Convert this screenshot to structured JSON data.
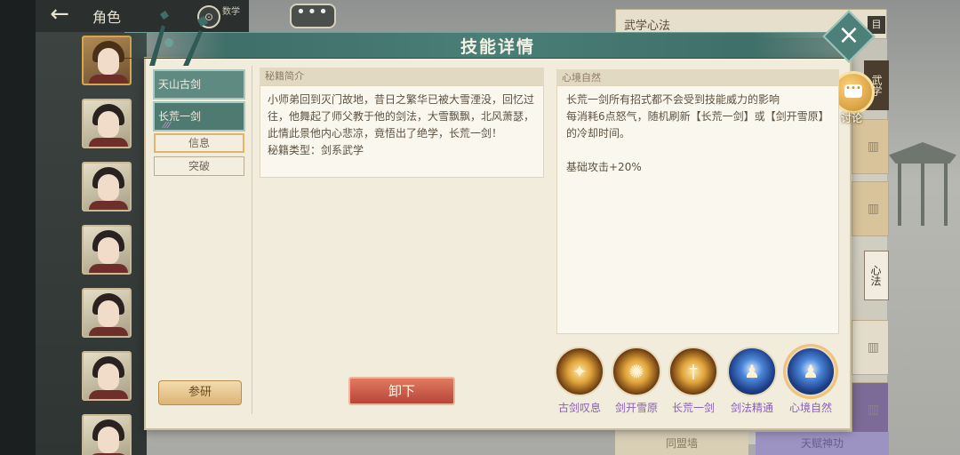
{
  "topbar": {
    "back_icon": "←",
    "title": "角色",
    "small_label": "数学",
    "round_btn_icon": "⊙",
    "chat_icon": "•••"
  },
  "right_panel": {
    "title": "武学心法",
    "tag1": "武学",
    "tag2": "心法",
    "icon": "目"
  },
  "dialog": {
    "title": "技能详情",
    "close_icon": "×",
    "discuss_label": "讨论",
    "discuss_icon": "•••"
  },
  "left_tabs": {
    "tab1": "天山古剑",
    "tab2": "长荒一剑",
    "tab2_pips": "⁄⁄⁄",
    "sub_info": "信息",
    "sub_break": "突破",
    "study_button": "参研"
  },
  "intro": {
    "header": "秘籍简介",
    "text": "小师弟回到灭门故地，昔日之繁华已被大雪湮没，回忆过往，他舞起了师父教于他的剑法，大雪飘飘，北风萧瑟，此情此景他内心悲凉，竟悟出了绝学，长荒一剑！",
    "type_line": "秘籍类型：剑系武学"
  },
  "unload_button": "卸下",
  "effect": {
    "header": "心境自然",
    "line1": "长荒一剑所有招式都不会受到技能威力的影响",
    "line2": "每消耗6点怒气，随机刷新【长荒一剑】或【剑开雪原】的冷却时间。",
    "line3": "基础攻击+20%"
  },
  "skills": [
    {
      "name": "古剑叹息",
      "glyph": "✦"
    },
    {
      "name": "剑开雪原",
      "glyph": "✺"
    },
    {
      "name": "长荒一剑",
      "glyph": "†"
    },
    {
      "name": "剑法精通",
      "glyph": "♟"
    },
    {
      "name": "心境自然",
      "glyph": "♟"
    }
  ],
  "bottom_labels": {
    "left": "同盟墙",
    "right": "天赋神功"
  }
}
